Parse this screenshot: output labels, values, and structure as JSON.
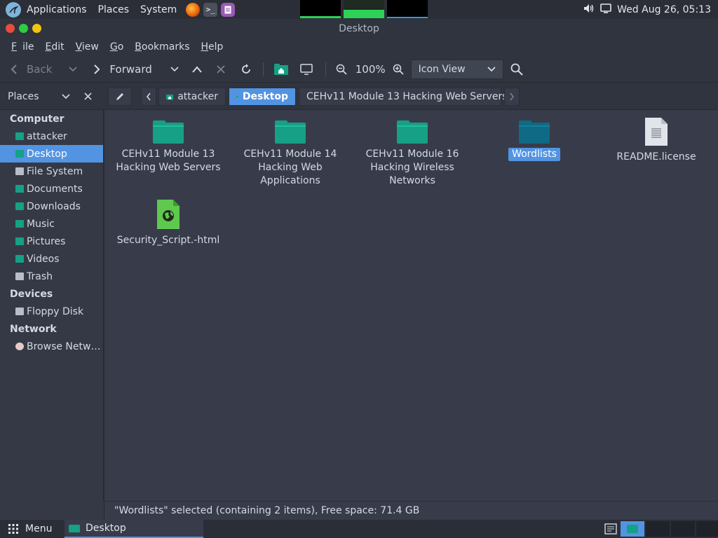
{
  "top_panel": {
    "menus": [
      "Applications",
      "Places",
      "System"
    ],
    "clock": "Wed Aug 26, 05:13",
    "monitor_levels": [
      0.1,
      0.45,
      0.08
    ]
  },
  "window": {
    "title": "Desktop"
  },
  "menubar": {
    "items": [
      {
        "label": "File",
        "mnemonic": "F",
        "rest": "ile"
      },
      {
        "label": "Edit",
        "mnemonic": "E",
        "rest": "dit"
      },
      {
        "label": "View",
        "mnemonic": "V",
        "rest": "iew"
      },
      {
        "label": "Go",
        "mnemonic": "G",
        "rest": "o"
      },
      {
        "label": "Bookmarks",
        "mnemonic": "B",
        "rest": "ookmarks"
      },
      {
        "label": "Help",
        "mnemonic": "H",
        "rest": "elp"
      }
    ]
  },
  "toolbar": {
    "back_label": "Back",
    "forward_label": "Forward",
    "zoom_level": "100%",
    "view_mode": "Icon View"
  },
  "sidebar_header": {
    "label": "Places"
  },
  "pathbar": {
    "segments": [
      "attacker",
      "Desktop",
      "CEHv11 Module 13 Hacking Web Servers"
    ]
  },
  "sidebar": {
    "computer_title": "Computer",
    "computer_items": [
      {
        "label": "attacker",
        "icon": "home-icon"
      },
      {
        "label": "Desktop",
        "icon": "desktop-icon"
      },
      {
        "label": "File System",
        "icon": "drive-icon"
      },
      {
        "label": "Documents",
        "icon": "folder-icon"
      },
      {
        "label": "Downloads",
        "icon": "folder-icon"
      },
      {
        "label": "Music",
        "icon": "music-folder-icon"
      },
      {
        "label": "Pictures",
        "icon": "pictures-folder-icon"
      },
      {
        "label": "Videos",
        "icon": "videos-folder-icon"
      },
      {
        "label": "Trash",
        "icon": "trash-icon"
      }
    ],
    "devices_title": "Devices",
    "device_items": [
      {
        "label": "Floppy Disk",
        "icon": "floppy-icon"
      }
    ],
    "network_title": "Network",
    "network_items": [
      {
        "label": "Browse Netw…",
        "icon": "network-icon"
      }
    ]
  },
  "files": [
    {
      "name": "CEHv11 Module 13 Hacking Web Servers",
      "type": "folder"
    },
    {
      "name": "CEHv11 Module 14 Hacking Web Applications",
      "type": "folder"
    },
    {
      "name": "CEHv11 Module 16 Hacking Wireless Networks",
      "type": "folder"
    },
    {
      "name": "Wordlists",
      "type": "folder",
      "selected": true
    },
    {
      "name": "README.license",
      "type": "text-file"
    },
    {
      "name": "Security_Script.-html",
      "type": "html-file"
    }
  ],
  "status": {
    "text": "\"Wordlists\" selected (containing 2 items), Free space: 71.4 GB"
  },
  "bottom_panel": {
    "menu_label": "Menu",
    "task_label": "Desktop"
  },
  "colors": {
    "accent": "#5294e2",
    "folder": "#16a085",
    "folder_selected": "#0e6a85"
  }
}
